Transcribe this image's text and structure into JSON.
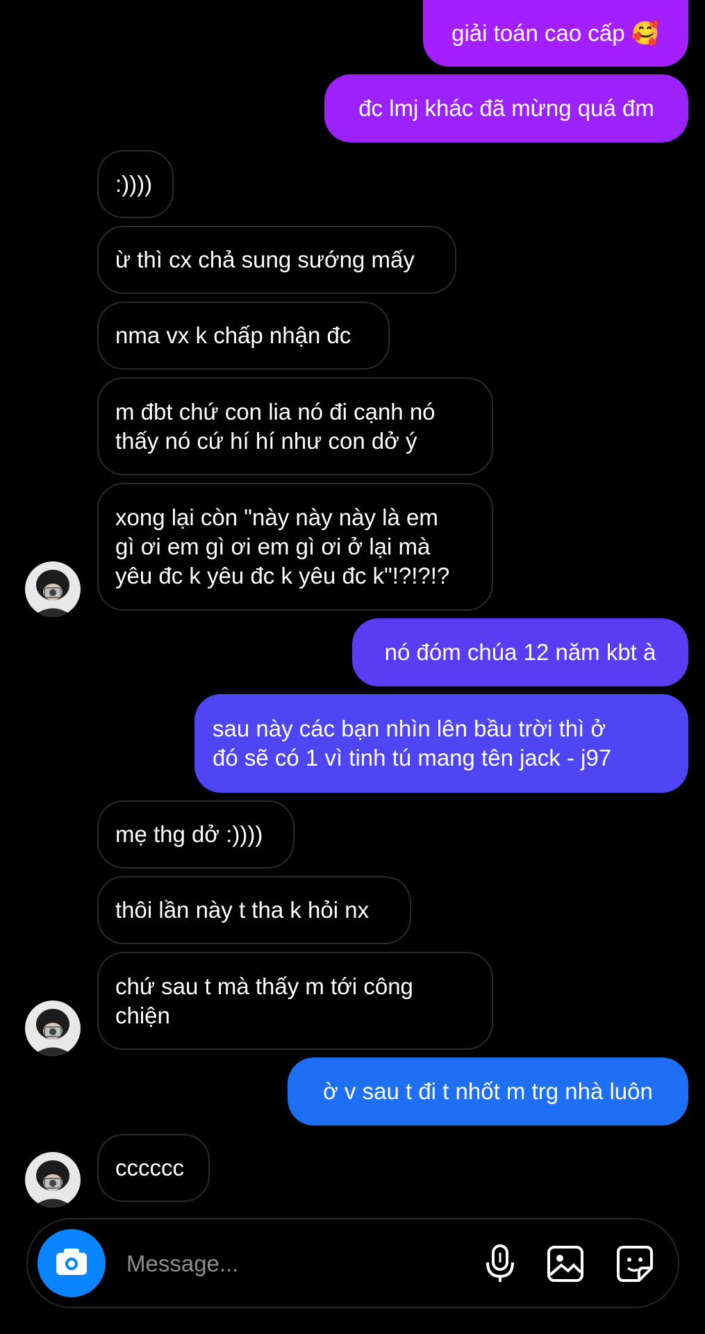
{
  "messages": [
    {
      "dir": "out",
      "text": "giải toán cao cấp 🥰"
    },
    {
      "dir": "out",
      "text": "đc lmj khác đã mừng quá đm"
    },
    {
      "dir": "in",
      "text": ":))))"
    },
    {
      "dir": "in",
      "text": "ừ thì cx chả sung sướng mấy"
    },
    {
      "dir": "in",
      "text": "nma vx k chấp nhận đc"
    },
    {
      "dir": "in",
      "text": "m đbt chứ con lia nó đi cạnh nó\nthấy nó cứ hí hí như con dở ý"
    },
    {
      "dir": "in",
      "text": "xong lại còn \"này này này là em\ngì ơi em gì ơi em gì ơi ở lại mà\nyêu đc k yêu đc k yêu đc k\"!?!?!?"
    },
    {
      "dir": "out",
      "text": "nó đóm chúa 12 năm kbt à"
    },
    {
      "dir": "out",
      "text": "sau này các bạn nhìn lên bầu trời thì ở\nđó sẽ có 1 vì tinh tú mang tên jack - j97"
    },
    {
      "dir": "in",
      "text": "mẹ thg dở :))))"
    },
    {
      "dir": "in",
      "text": "thôi lần này t tha k hỏi nx"
    },
    {
      "dir": "in",
      "text": "chứ sau t mà thấy m tới công\nchiện"
    },
    {
      "dir": "out",
      "text": "ờ v sau t đi t nhốt m trg nhà luôn"
    },
    {
      "dir": "in",
      "text": "cccccc"
    }
  ],
  "composer": {
    "placeholder": "Message...",
    "icons": [
      "camera-icon",
      "microphone-icon",
      "gallery-icon",
      "sticker-icon"
    ]
  },
  "colors": {
    "out_top": "#a322ff",
    "out_mid": "#5a3df2",
    "out_bottom": "#1f6ff5",
    "incoming_border": "#2b2b2b",
    "camera": "#0a84ff"
  }
}
